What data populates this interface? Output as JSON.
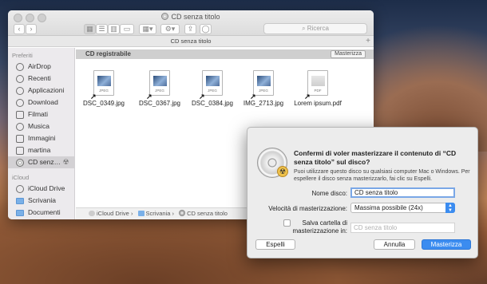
{
  "finder": {
    "window_title": "CD senza titolo",
    "search_placeholder": "Ricerca",
    "tab_title": "CD senza titolo",
    "toolbar": {
      "back_icon": "chevron-left",
      "forward_icon": "chevron-right"
    },
    "sidebar": {
      "favorites_header": "Preferiti",
      "items": [
        {
          "label": "AirDrop",
          "icon": "airdrop"
        },
        {
          "label": "Recenti",
          "icon": "clock"
        },
        {
          "label": "Applicazioni",
          "icon": "applications"
        },
        {
          "label": "Download",
          "icon": "download"
        },
        {
          "label": "Filmati",
          "icon": "film"
        },
        {
          "label": "Musica",
          "icon": "music"
        },
        {
          "label": "Immagini",
          "icon": "camera"
        },
        {
          "label": "martina",
          "icon": "home"
        },
        {
          "label": "CD senz…",
          "icon": "disc",
          "selected": true
        }
      ],
      "icloud_header": "iCloud",
      "icloud_items": [
        {
          "label": "iCloud Drive",
          "icon": "cloud"
        },
        {
          "label": "Scrivania",
          "icon": "folder"
        },
        {
          "label": "Documenti",
          "icon": "folder"
        }
      ]
    },
    "content": {
      "header": "CD registrabile",
      "burn_button": "Masterizza",
      "files": [
        {
          "name": "DSC_0349.jpg",
          "type": "JPEG"
        },
        {
          "name": "DSC_0367.jpg",
          "type": "JPEG"
        },
        {
          "name": "DSC_0384.jpg",
          "type": "JPEG"
        },
        {
          "name": "IMG_2713.jpg",
          "type": "JPEG"
        },
        {
          "name": "Lorem ipsum.pdf",
          "type": "PDF"
        }
      ]
    },
    "path": {
      "sep": "›",
      "items": [
        "iCloud Drive",
        "Scrivania",
        "CD senza titolo"
      ]
    }
  },
  "dialog": {
    "title": "Confermi di voler masterizzare il contenuto di “CD senza titolo” sul disco?",
    "description": "Puoi utilizzare questo disco su qualsiasi computer Mac o Windows. Per espellere il disco senza masterizzarlo, fai clic su Espelli.",
    "disc_name_label": "Nome disco:",
    "disc_name_value": "CD senza titolo",
    "speed_label": "Velocità di masterizzazione:",
    "speed_value": "Massima possibile (24x)",
    "save_folder_label_1": "Salva cartella di",
    "save_folder_label_2": "masterizzazione in:",
    "save_folder_value": "CD senza titolo",
    "eject_button": "Espelli",
    "cancel_button": "Annulla",
    "burn_button": "Masterizza",
    "radiation_symbol": "☢"
  }
}
